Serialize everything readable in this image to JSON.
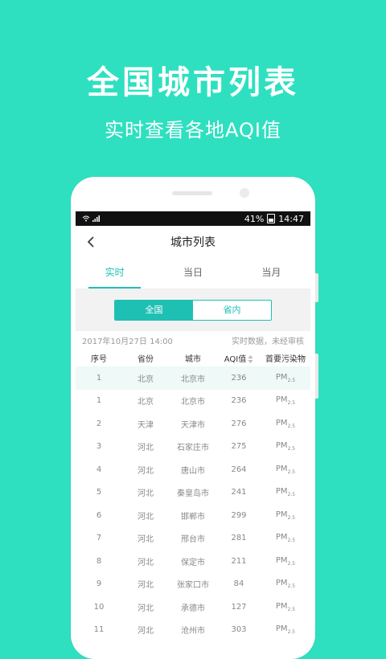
{
  "promo": {
    "title": "全国城市列表",
    "subtitle": "实时查看各地AQI值"
  },
  "status_bar": {
    "battery": "41%",
    "time": "14:47"
  },
  "nav": {
    "title": "城市列表"
  },
  "tabs": [
    {
      "label": "实时",
      "active": true
    },
    {
      "label": "当日",
      "active": false
    },
    {
      "label": "当月",
      "active": false
    }
  ],
  "segment": [
    {
      "label": "全国",
      "active": true
    },
    {
      "label": "省内",
      "active": false
    }
  ],
  "meta": {
    "datetime": "2017年10月27日 14:00",
    "note": "实时数据，未经审核"
  },
  "table": {
    "headers": [
      "序号",
      "省份",
      "城市",
      "AQI值",
      "首要污染物"
    ],
    "rows": [
      {
        "idx": "1",
        "province": "北京",
        "city": "北京市",
        "aqi": "236",
        "pollutant": "PM",
        "pollutant_sub": "2.5"
      },
      {
        "idx": "1",
        "province": "北京",
        "city": "北京市",
        "aqi": "236",
        "pollutant": "PM",
        "pollutant_sub": "2.5"
      },
      {
        "idx": "2",
        "province": "天津",
        "city": "天津市",
        "aqi": "276",
        "pollutant": "PM",
        "pollutant_sub": "2.5"
      },
      {
        "idx": "3",
        "province": "河北",
        "city": "石家庄市",
        "aqi": "275",
        "pollutant": "PM",
        "pollutant_sub": "2.5"
      },
      {
        "idx": "4",
        "province": "河北",
        "city": "唐山市",
        "aqi": "264",
        "pollutant": "PM",
        "pollutant_sub": "2.5"
      },
      {
        "idx": "5",
        "province": "河北",
        "city": "秦皇岛市",
        "aqi": "241",
        "pollutant": "PM",
        "pollutant_sub": "2.5"
      },
      {
        "idx": "6",
        "province": "河北",
        "city": "邯郸市",
        "aqi": "299",
        "pollutant": "PM",
        "pollutant_sub": "2.5"
      },
      {
        "idx": "7",
        "province": "河北",
        "city": "邢台市",
        "aqi": "281",
        "pollutant": "PM",
        "pollutant_sub": "2.5"
      },
      {
        "idx": "8",
        "province": "河北",
        "city": "保定市",
        "aqi": "211",
        "pollutant": "PM",
        "pollutant_sub": "2.5"
      },
      {
        "idx": "9",
        "province": "河北",
        "city": "张家口市",
        "aqi": "84",
        "pollutant": "PM",
        "pollutant_sub": "2.5"
      },
      {
        "idx": "10",
        "province": "河北",
        "city": "承德市",
        "aqi": "127",
        "pollutant": "PM",
        "pollutant_sub": "2.5"
      },
      {
        "idx": "11",
        "province": "河北",
        "city": "沧州市",
        "aqi": "303",
        "pollutant": "PM",
        "pollutant_sub": "2.5"
      }
    ]
  },
  "colors": {
    "background": "#2ee0c0",
    "accent": "#1fc0b4",
    "highlight_row": "#eef9f8"
  }
}
